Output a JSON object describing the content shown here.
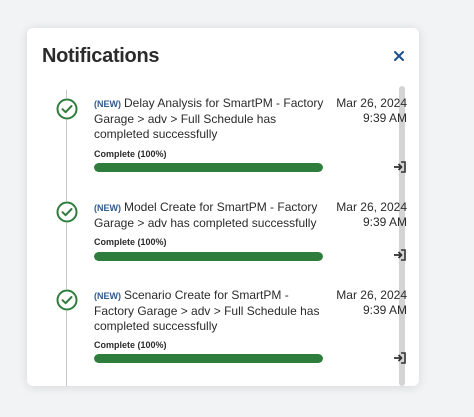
{
  "panel": {
    "title": "Notifications",
    "close_icon": "close-icon"
  },
  "notifications": [
    {
      "tag": "(NEW)",
      "message": "Delay Analysis for SmartPM - Factory Garage > adv > Full Schedule has completed successfully",
      "date": "Mar 26, 2024",
      "time": "9:39 AM",
      "status_label": "Complete (100%)",
      "progress": 1.0,
      "icon": "check-circle-icon",
      "action_icon": "open-link-icon"
    },
    {
      "tag": "(NEW)",
      "message": "Model Create for SmartPM - Factory Garage > adv has completed successfully",
      "date": "Mar 26, 2024",
      "time": "9:39 AM",
      "status_label": "Complete (100%)",
      "progress": 1.0,
      "icon": "check-circle-icon",
      "action_icon": "open-link-icon"
    },
    {
      "tag": "(NEW)",
      "message": "Scenario Create for SmartPM - Factory Garage > adv > Full Schedule has completed successfully",
      "date": "Mar 26, 2024",
      "time": "9:39 AM",
      "status_label": "Complete (100%)",
      "progress": 1.0,
      "icon": "check-circle-icon",
      "action_icon": "open-link-icon"
    }
  ],
  "colors": {
    "success": "#2e7d3c",
    "new_tag": "#2d5c96",
    "close": "#1f4e8c"
  }
}
